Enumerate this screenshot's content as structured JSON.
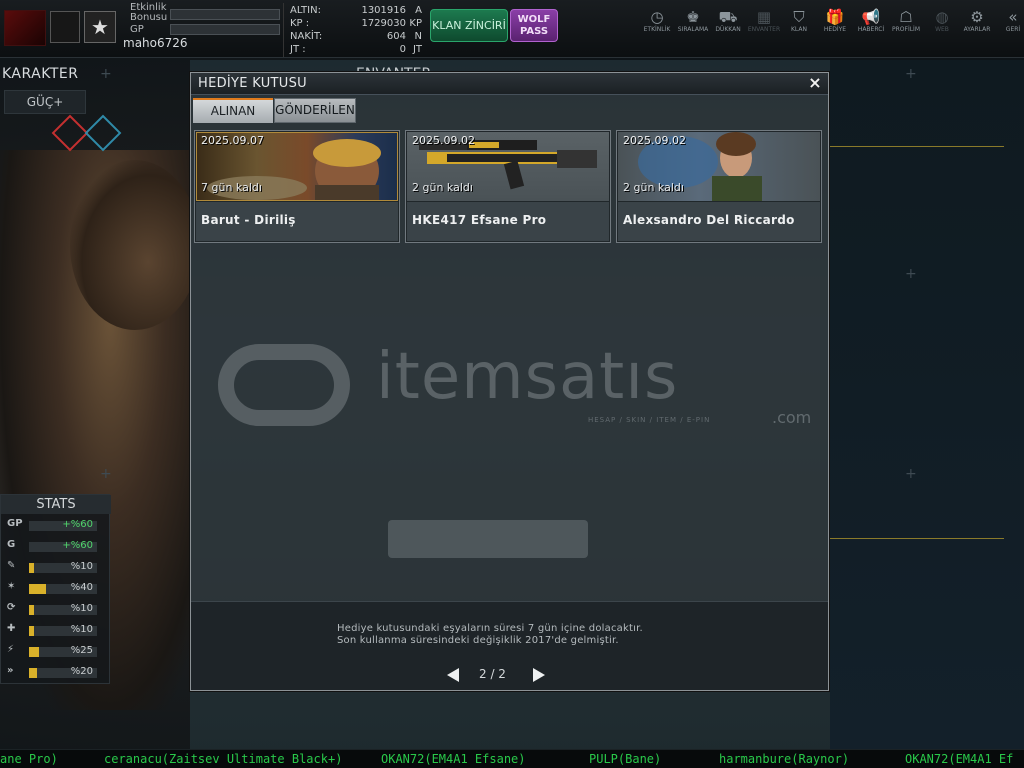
{
  "topbar": {
    "event_bonus_label": "Etkinlik Bonusu",
    "gp_label": "GP",
    "username": "maho6726",
    "currencies": [
      {
        "name": "ALTIN:",
        "value": "1301916",
        "unit": "A"
      },
      {
        "name": "KP :",
        "value": "1729030",
        "unit": "KP"
      },
      {
        "name": "NAKİT:",
        "value": "604",
        "unit": "N"
      },
      {
        "name": "JT :",
        "value": "0",
        "unit": "JT"
      }
    ],
    "clan_chain_label": "KLAN ZİNCİRİ",
    "wolf_pass_label": "WOLF PASS",
    "nav": [
      {
        "label": "ETKİNLİK",
        "icon": "clock-icon",
        "glyph": "◷"
      },
      {
        "label": "SIRALAMA",
        "icon": "medal-icon",
        "glyph": "♚"
      },
      {
        "label": "DÜKKAN",
        "icon": "cart-icon",
        "glyph": "⛟"
      },
      {
        "label": "ENVANTER",
        "icon": "inventory-icon",
        "glyph": "▦"
      },
      {
        "label": "KLAN",
        "icon": "shield-icon",
        "glyph": "⛉"
      },
      {
        "label": "HEDİYE",
        "icon": "gift-icon",
        "glyph": "🎁"
      },
      {
        "label": "HABERCİ",
        "icon": "megaphone-icon",
        "glyph": "📢"
      },
      {
        "label": "PROFİLİM",
        "icon": "profile-icon",
        "glyph": "☖"
      },
      {
        "label": "WEB",
        "icon": "globe-icon",
        "glyph": "◍"
      },
      {
        "label": "AYARLAR",
        "icon": "gear-icon",
        "glyph": "⚙"
      },
      {
        "label": "GERİ",
        "icon": "back-icon",
        "glyph": "«"
      }
    ]
  },
  "left": {
    "title": "KARAKTER",
    "tab": "GÜÇ+",
    "stats_title": "STATS",
    "stats": [
      {
        "icon": "GP",
        "value": "+%60",
        "fill": 0,
        "green": true
      },
      {
        "icon": "G",
        "value": "+%60",
        "fill": 0,
        "green": true
      },
      {
        "icon": "✎",
        "value": "%10",
        "fill": 0.08,
        "green": false
      },
      {
        "icon": "✶",
        "value": "%40",
        "fill": 0.25,
        "green": false
      },
      {
        "icon": "⟳",
        "value": "%10",
        "fill": 0.08,
        "green": false
      },
      {
        "icon": "✚",
        "value": "%10",
        "fill": 0.08,
        "green": false
      },
      {
        "icon": "⚡",
        "value": "%25",
        "fill": 0.15,
        "green": false
      },
      {
        "icon": "»",
        "value": "%20",
        "fill": 0.12,
        "green": false
      }
    ]
  },
  "envanter_title": "ENVANTER",
  "modal": {
    "title": "HEDİYE KUTUSU",
    "close": "×",
    "tabs": {
      "received": "ALINAN",
      "sent": "GÖNDERİLEN"
    },
    "gifts": [
      {
        "date": "2025.09.07",
        "remaining": "7 gün kaldı",
        "name": "Barut - Diriliş"
      },
      {
        "date": "2025.09.02",
        "remaining": "2 gün kaldı",
        "name": "HKE417 Efsane Pro"
      },
      {
        "date": "2025.09.02",
        "remaining": "2 gün kaldı",
        "name": "Alexsandro Del Riccardo"
      }
    ],
    "info_line_1": "Hediye kutusundaki eşyaların süresi 7 gün içine dolacaktır.",
    "info_line_2": "Son kullanma süresindeki değişiklik 2017'de gelmiştir.",
    "pager": "2 / 2"
  },
  "watermark": {
    "brand": "itemsatıs",
    "tagline": "HESAP / SKIN / ITEM / E-PIN",
    "suffix": ".com"
  },
  "ticker": [
    "ane Pro)",
    "ceranacu(Zaitsev Ultimate Black+)",
    "OKAN72(EM4A1 Efsane)",
    "PULP(Bane)",
    "harmanbure(Raynor)",
    "OKAN72(EM4A1 Ef"
  ]
}
